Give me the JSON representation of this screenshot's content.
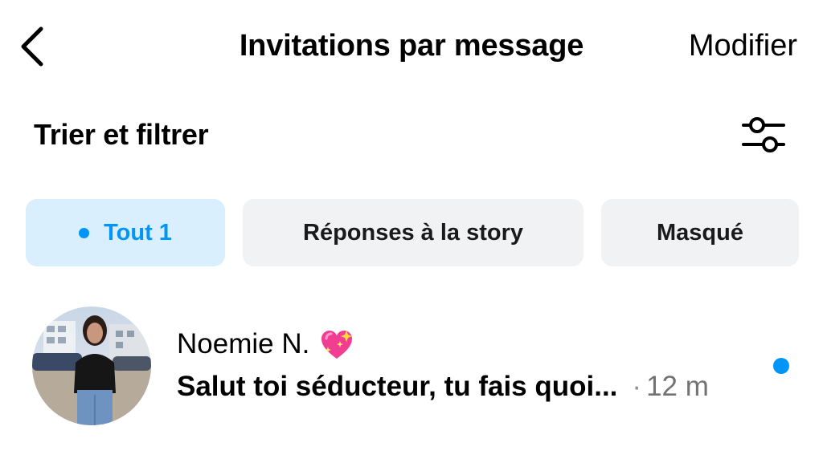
{
  "header": {
    "back_icon": "chevron-left-icon",
    "title": "Invitations par message",
    "edit_label": "Modifier"
  },
  "sort": {
    "label": "Trier et filtrer",
    "icon": "sliders-icon"
  },
  "chips": [
    {
      "label": "Tout 1",
      "active": true
    },
    {
      "label": "Réponses à la story",
      "active": false
    },
    {
      "label": "Masqué",
      "active": false
    }
  ],
  "requests": [
    {
      "name": "Noemie N.",
      "emoji": "💖",
      "preview": "Salut toi séducteur, tu fais quoi...",
      "separator": "·",
      "time": "12 m",
      "unread": true
    }
  ],
  "colors": {
    "accent": "#0095f6",
    "active_chip_bg": "#d9effd",
    "chip_bg": "#f0f2f4",
    "muted_text": "#737373"
  }
}
